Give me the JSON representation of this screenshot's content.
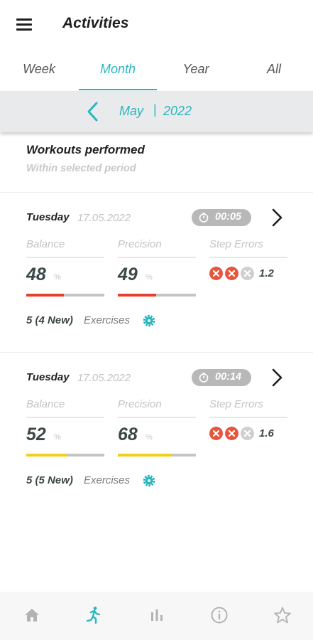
{
  "header": {
    "title": "Activities",
    "menu_icon": "hamburger-menu-icon"
  },
  "tabs": [
    {
      "label": "Week",
      "active": false
    },
    {
      "label": "Month",
      "active": true
    },
    {
      "label": "Year",
      "active": false
    },
    {
      "label": "All",
      "active": false
    }
  ],
  "period": {
    "prev_icon": "chevron-left-icon",
    "month": "May",
    "separator": "|",
    "year": "2022"
  },
  "section": {
    "title": "Workouts performed",
    "subtitle": "Within selected period"
  },
  "workouts": [
    {
      "day": "Tuesday",
      "date": "17.05.2022",
      "duration": "00:05",
      "balance": {
        "label": "Balance",
        "value": "48",
        "unit": "%",
        "bar_color": "#e5412d"
      },
      "precision": {
        "label": "Precision",
        "value": "49",
        "unit": "%",
        "bar_color": "#e5412d"
      },
      "step_errors": {
        "label": "Step Errors",
        "value": "1.2",
        "icons": [
          "#e8553c",
          "#e8553c",
          "#cfcfcf"
        ]
      },
      "exercises": {
        "count": "5 (4 New)",
        "label": "Exercises"
      }
    },
    {
      "day": "Tuesday",
      "date": "17.05.2022",
      "duration": "00:14",
      "balance": {
        "label": "Balance",
        "value": "52",
        "unit": "%",
        "bar_color": "#f4cf1a"
      },
      "precision": {
        "label": "Precision",
        "value": "68",
        "unit": "%",
        "bar_color": "#f4cf1a"
      },
      "step_errors": {
        "label": "Step Errors",
        "value": "1.6",
        "icons": [
          "#e8553c",
          "#e8553c",
          "#cfcfcf"
        ]
      },
      "exercises": {
        "count": "5 (5 New)",
        "label": "Exercises"
      }
    }
  ],
  "bottom_nav": [
    {
      "icon": "home-icon",
      "active": false
    },
    {
      "icon": "running-person-icon",
      "active": true
    },
    {
      "icon": "bar-chart-icon",
      "active": false
    },
    {
      "icon": "info-icon",
      "active": false
    },
    {
      "icon": "star-icon",
      "active": false
    }
  ],
  "colors": {
    "accent": "#2bb6c0",
    "error_active": "#e8553c",
    "error_inactive": "#cfcfcf",
    "bar_bad": "#e5412d",
    "bar_mid": "#f4cf1a"
  }
}
